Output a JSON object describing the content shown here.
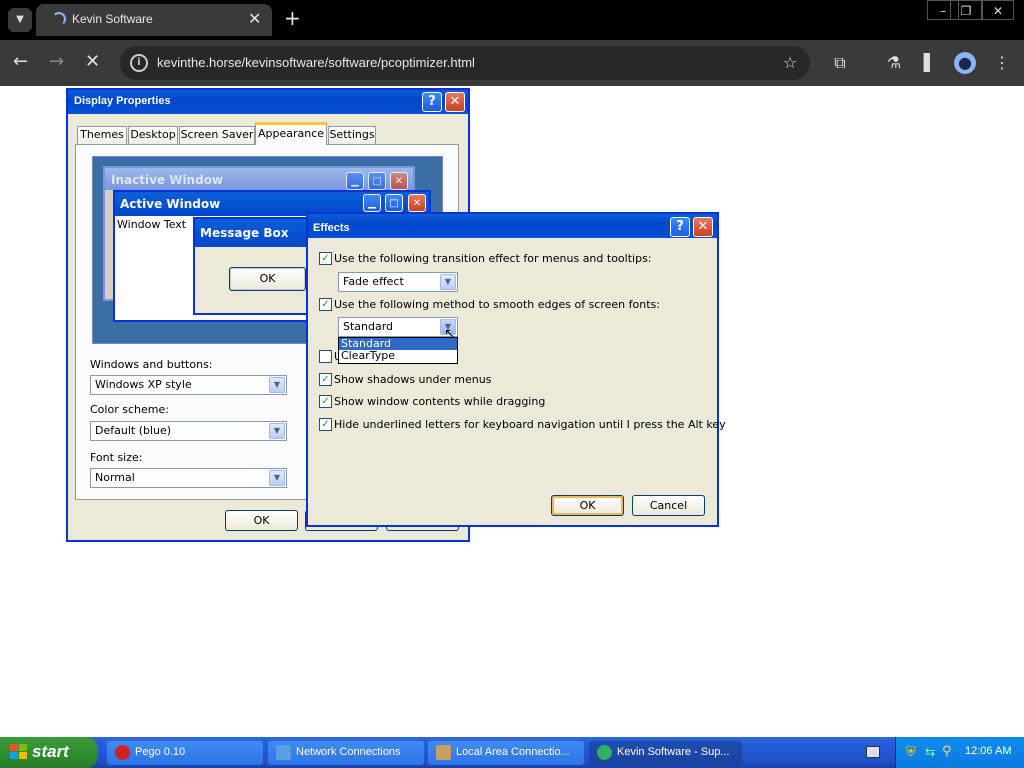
{
  "browser": {
    "tab_title": "Kevin Software",
    "url": "kevinthe.horse/kevinsoftware/software/pcoptimizer.html",
    "icons": {
      "tab_menu": "chevron-down-icon",
      "back": "back-arrow-icon",
      "forward": "forward-arrow-icon",
      "stop": "stop-icon",
      "bookmark": "star-icon",
      "extensions": "puzzle-icon",
      "labs": "flask-icon",
      "side_panel": "side-panel-icon",
      "profile": "profile-icon",
      "menu": "kebab-menu-icon"
    }
  },
  "display_properties": {
    "title": "Display Properties",
    "help": "?",
    "tabs": [
      "Themes",
      "Desktop",
      "Screen Saver",
      "Appearance",
      "Settings"
    ],
    "preview": {
      "inactive_title": "Inactive Window",
      "active_title": "Active Window",
      "window_text": "Window Text",
      "message_title": "Message Box",
      "ok": "OK"
    },
    "windows_buttons_label": "Windows and buttons:",
    "windows_buttons_value": "Windows XP style",
    "color_scheme_label": "Color scheme:",
    "color_scheme_value": "Default (blue)",
    "font_size_label": "Font size:",
    "font_size_value": "Normal",
    "ok": "OK"
  },
  "effects": {
    "title": "Effects",
    "help": "?",
    "option1": "Use the following transition effect for menus and tooltips:",
    "transition_value": "Fade effect",
    "option2": "Use the following method to smooth edges of screen fonts:",
    "smoothing_value": "Standard",
    "dropdown_options": [
      "Standard",
      "ClearType"
    ],
    "option3_partial": "U",
    "option4": "Show shadows under menus",
    "option5": "Show window contents while dragging",
    "option6": "Hide underlined letters for keyboard navigation until I press the Alt key",
    "checkmark": "✓",
    "ok": "OK",
    "cancel": "Cancel"
  },
  "taskbar": {
    "start": "start",
    "tasks": [
      "Pego 0.10",
      "Network Connections",
      "Local Area Connectio...",
      "Kevin Software - Sup..."
    ],
    "clock": "12:06 AM"
  },
  "colors": {
    "xp_blue": "#0a5fd8",
    "start_green": "#2f8f2f",
    "accent": "#8ab4f8"
  }
}
